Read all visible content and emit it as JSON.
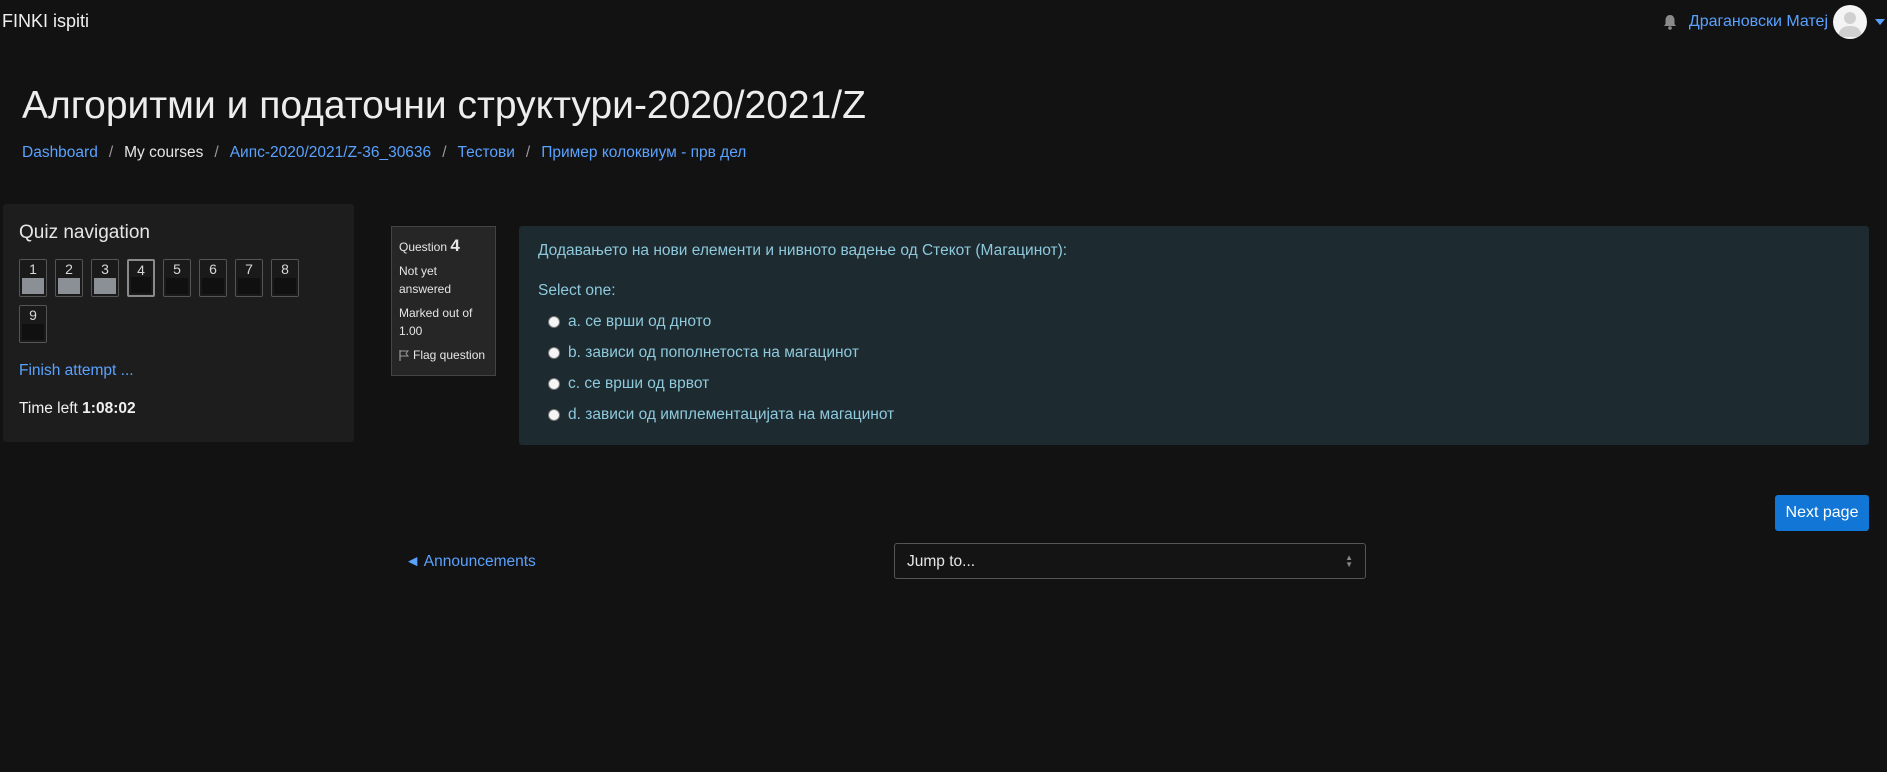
{
  "navbar": {
    "brand": "FINKI ispiti",
    "username": "Драгановски Матеј"
  },
  "header": {
    "title": "Алгоритми и податочни структури-2020/2021/Z",
    "breadcrumb": [
      {
        "label": "Dashboard",
        "link": true
      },
      {
        "label": "My courses",
        "link": false
      },
      {
        "label": "Аипс-2020/2021/Z-36_30636",
        "link": true
      },
      {
        "label": "Тестови",
        "link": true
      },
      {
        "label": "Пример колоквиум - прв дел",
        "link": true
      }
    ]
  },
  "quiz_nav": {
    "title": "Quiz navigation",
    "questions": [
      {
        "label": "1",
        "state": "answered"
      },
      {
        "label": "2",
        "state": "answered"
      },
      {
        "label": "3",
        "state": "answered"
      },
      {
        "label": "4",
        "state": "current"
      },
      {
        "label": "5",
        "state": "unanswered"
      },
      {
        "label": "6",
        "state": "unanswered"
      },
      {
        "label": "7",
        "state": "unanswered"
      },
      {
        "label": "8",
        "state": "unanswered"
      },
      {
        "label": "9",
        "state": "unanswered"
      }
    ],
    "finish_label": "Finish attempt ...",
    "time_left_label": "Time left",
    "time_left_value": "1:08:02"
  },
  "question_info": {
    "question_label": "Question",
    "question_number": "4",
    "status": "Not yet answered",
    "marked": "Marked out of 1.00",
    "flag_label": "Flag question"
  },
  "question": {
    "text": "Додавањето на нови елементи и нивното вадење од Стекот (Магацинот):",
    "prompt": "Select one:",
    "answers": [
      "a. се врши од дното",
      "b. зависи од пополнетоста на магацинот",
      "c. се врши од врвот",
      "d. зависи од имплементацијата на магацинот"
    ]
  },
  "footer": {
    "next_label": "Next page",
    "prev_link_label": "◄ Announcements",
    "jump_label": "Jump to..."
  }
}
